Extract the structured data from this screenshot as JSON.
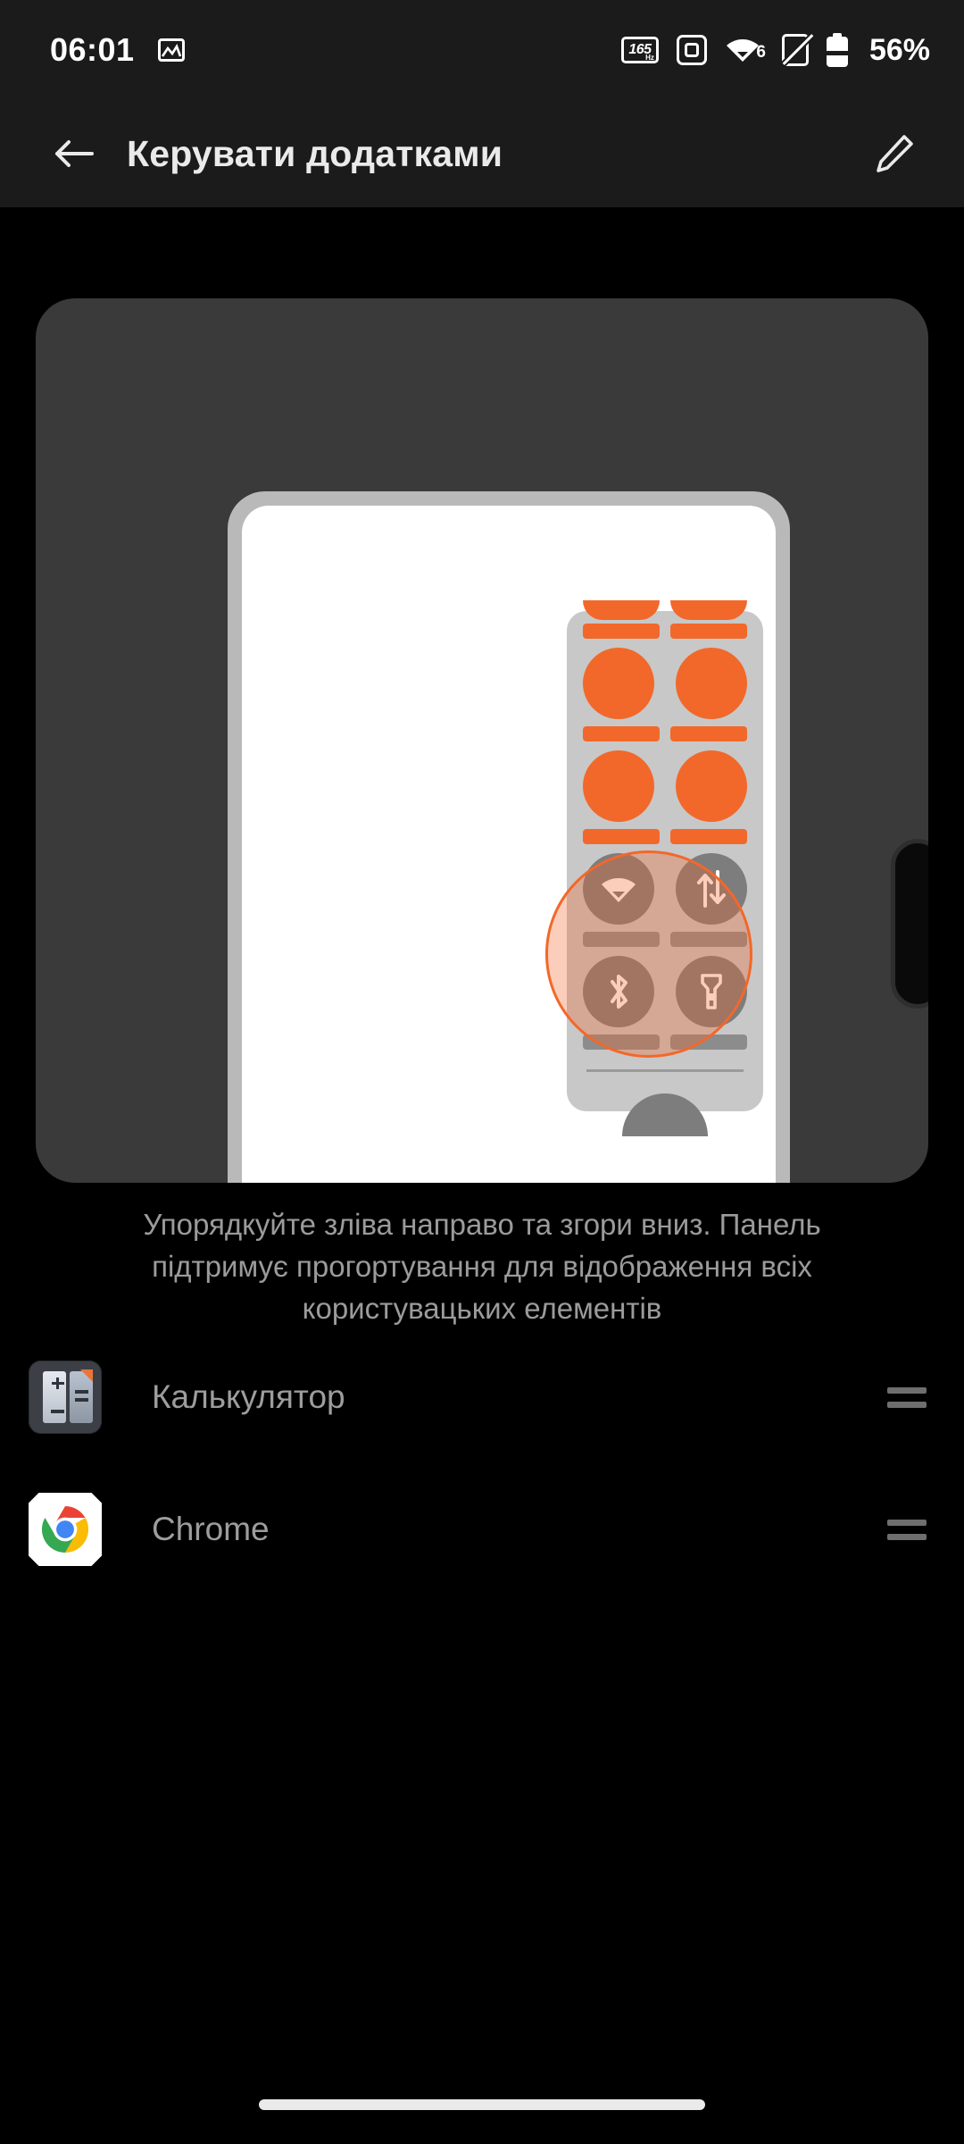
{
  "status_bar": {
    "time": "06:01",
    "left_icons": [
      "screenshot-icon"
    ],
    "refresh_rate": "165",
    "refresh_unit": "Hz",
    "wifi_generation": "6",
    "battery_percent": "56%",
    "right_icons": [
      "refresh-rate-icon",
      "screen-rotation-icon",
      "wifi-6-icon",
      "mute-icon",
      "battery-icon"
    ]
  },
  "app_bar": {
    "back_icon": "arrow-left-icon",
    "title": "Керувати додатками",
    "edit_icon": "pencil-icon"
  },
  "illustration": {
    "description": "Упорядкуйте зліва направо та згори вниз. Панель підтримує прогортування для відображення всіх користувацьких елементів",
    "panel_icons": [
      "wifi-icon",
      "data-transfer-icon",
      "bluetooth-icon",
      "flashlight-icon"
    ],
    "accent_color": "#f2682a",
    "panel_color": "#c8c8c8"
  },
  "list": {
    "items": [
      {
        "label": "Калькулятор",
        "icon": "calculator-icon",
        "handle": "drag-handle-icon"
      },
      {
        "label": "Chrome",
        "icon": "chrome-icon",
        "handle": "drag-handle-icon"
      }
    ]
  },
  "nav_bar": {
    "gesture_pill": "home-indicator"
  }
}
